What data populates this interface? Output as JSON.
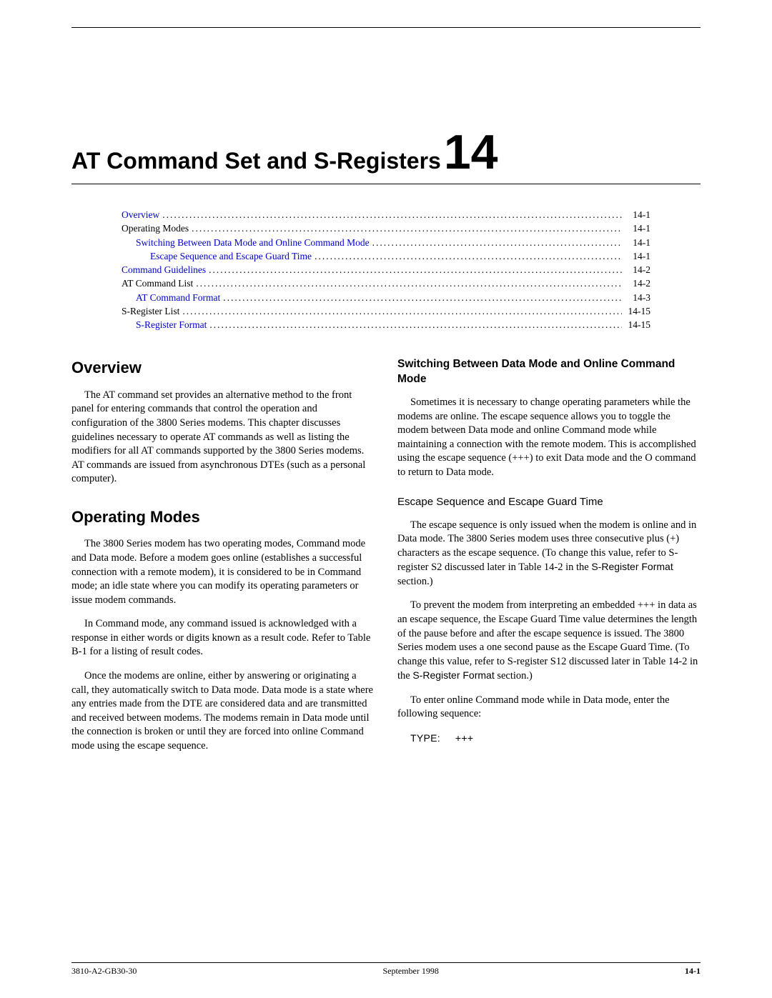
{
  "chapter": {
    "title": "AT Command Set and S-Registers",
    "number": "14"
  },
  "toc": [
    {
      "label": "Overview",
      "page": "14-1",
      "indent": 0,
      "link": true
    },
    {
      "label": "Operating Modes",
      "page": "14-1",
      "indent": 0,
      "link": false
    },
    {
      "label": "Switching Between Data Mode and Online Command Mode",
      "page": "14-1",
      "indent": 1,
      "link": true
    },
    {
      "label": "Escape Sequence and Escape Guard Time",
      "page": "14-1",
      "indent": 2,
      "link": true
    },
    {
      "label": "Command Guidelines",
      "page": "14-2",
      "indent": 0,
      "link": true
    },
    {
      "label": "AT Command List",
      "page": "14-2",
      "indent": 0,
      "link": false
    },
    {
      "label": "AT Command Format",
      "page": "14-3",
      "indent": 1,
      "link": true
    },
    {
      "label": "S-Register List",
      "page": "14-15",
      "indent": 0,
      "link": false
    },
    {
      "label": "S-Register Format",
      "page": "14-15",
      "indent": 1,
      "link": true
    }
  ],
  "left": {
    "h_overview": "Overview",
    "p_overview": "The AT command set provides an alternative method to the front panel for entering commands that control the operation and configuration of the 3800 Series modems. This chapter discusses guidelines necessary to operate AT commands as well as listing the modifiers for all AT commands supported by the 3800 Series modems. AT commands are issued from asynchronous DTEs (such as a personal computer).",
    "h_opmodes": "Operating Modes",
    "p_op1": "The 3800 Series modem has two operating modes, Command mode and Data mode. Before a modem goes online (establishes a successful connection with a remote modem), it is considered to be in Command mode; an idle state where you can modify its operating parameters or issue modem commands.",
    "p_op2": "In Command mode, any command issued is acknowledged with a response in either words or digits known as a result code. Refer to Table B-1 for a listing of result codes.",
    "p_op3": "Once the modems are online, either by answering or originating a call, they automatically switch to Data mode. Data mode is a state where any entries made from the DTE are considered data and are transmitted and received between modems. The modems remain in Data mode until the connection is broken or until they are forced into online Command mode using the escape sequence."
  },
  "right": {
    "h_switch": "Switching Between Data Mode and Online Command Mode",
    "p_switch": "Sometimes it is necessary to change operating parameters while the modems are online. The escape sequence allows you to toggle the modem between Data mode and online Command mode while maintaining a connection with the remote modem. This is accomplished using the escape sequence (+++) to exit Data mode and the O command to return to Data mode.",
    "h_escape": "Escape Sequence and Escape Guard Time",
    "p_esc1_a": "The escape sequence is only issued when the modem is online and in Data mode. The 3800 Series modem uses three consecutive plus (+) characters as the escape sequence. (To change this value, refer to S-register S2 discussed later in Table 14-2 in the ",
    "p_esc1_b": "S-Register Format",
    "p_esc1_c": " section.)",
    "p_esc2_a": "To prevent the modem from interpreting an embedded +++ in data as an escape sequence, the Escape Guard Time value determines the length of the pause before and after the escape sequence is issued. The 3800 Series modem uses a one second pause as the Escape Guard Time. (To change this value, refer to S-register S12 discussed later in Table 14-2 in the ",
    "p_esc2_b": "S-Register Format",
    "p_esc2_c": " section.)",
    "p_enter": "To enter online Command mode while in Data mode, enter the following sequence:",
    "type_label": "TYPE:",
    "type_value": "+++"
  },
  "footer": {
    "left": "3810-A2-GB30-30",
    "center": "September 1998",
    "right": "14-1"
  }
}
